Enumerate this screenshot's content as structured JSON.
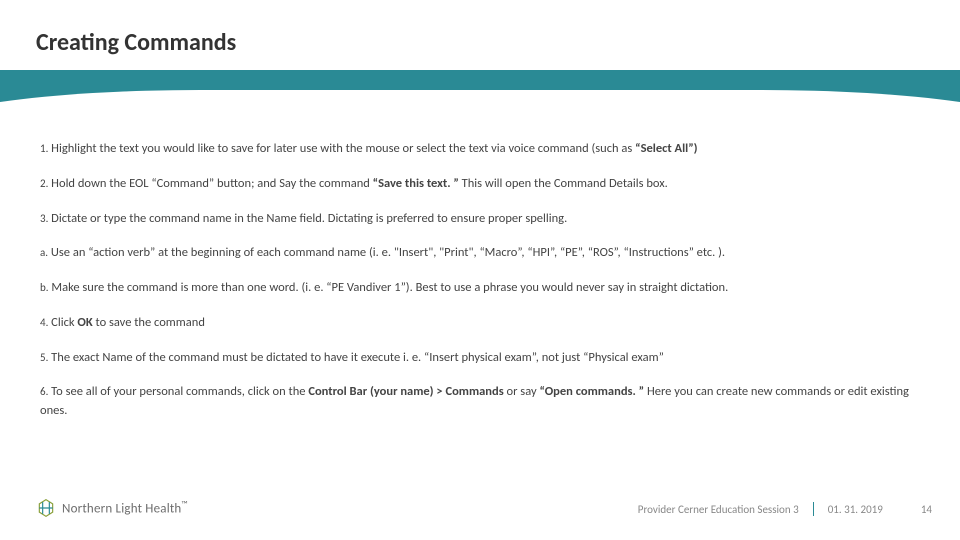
{
  "title": "Creating Commands",
  "items": [
    {
      "pre": "1.",
      "text": " Highlight the text you would like to save for later use with the mouse or select the text via voice command (such as ",
      "bold_tail": "“Select All”)"
    },
    {
      "pre": "2.",
      "text": " Hold down the EOL “Command” button; and Say the command ",
      "bold_mid": "“Save this text. ”",
      "text2": " This will open the Command Details box."
    },
    {
      "pre": "3.",
      "text": " Dictate or type the command name in the Name field. Dictating is preferred to ensure proper spelling."
    },
    {
      "pre": "a.",
      "text": " Use an “action verb” at the beginning of each command name (i. e. \"Insert\", \"Print\", “Macro”, “HPI”, “PE”, “ROS”, “Instructions” etc. )."
    },
    {
      "pre": "b.",
      "text": " Make sure the command is more than one word. (i. e. “PE Vandiver 1”). Best to use a phrase you would never say in straight dictation."
    },
    {
      "pre": "4.",
      "text": " Click ",
      "bold_mid": "OK",
      "text2": " to save the command"
    },
    {
      "pre": "5.",
      "text": " The exact Name of the command must be dictated to have it execute i. e. “Insert physical exam”, not just “Physical exam”"
    },
    {
      "pre": "6.",
      "text": " To see all of your personal commands, click on the ",
      "bold_mid": "Control Bar (your name) > Commands",
      "text2": " or say ",
      "bold_mid2": "“Open commands. ”",
      "text3": " Here you can create new commands or edit existing ones."
    }
  ],
  "logo": {
    "text": "Northern Light Health",
    "trademark": "™"
  },
  "footer": {
    "session": "Provider Cerner Education Session 3",
    "date": "01. 31. 2019",
    "page": "14"
  },
  "colors": {
    "brand": "#2a8a95"
  }
}
